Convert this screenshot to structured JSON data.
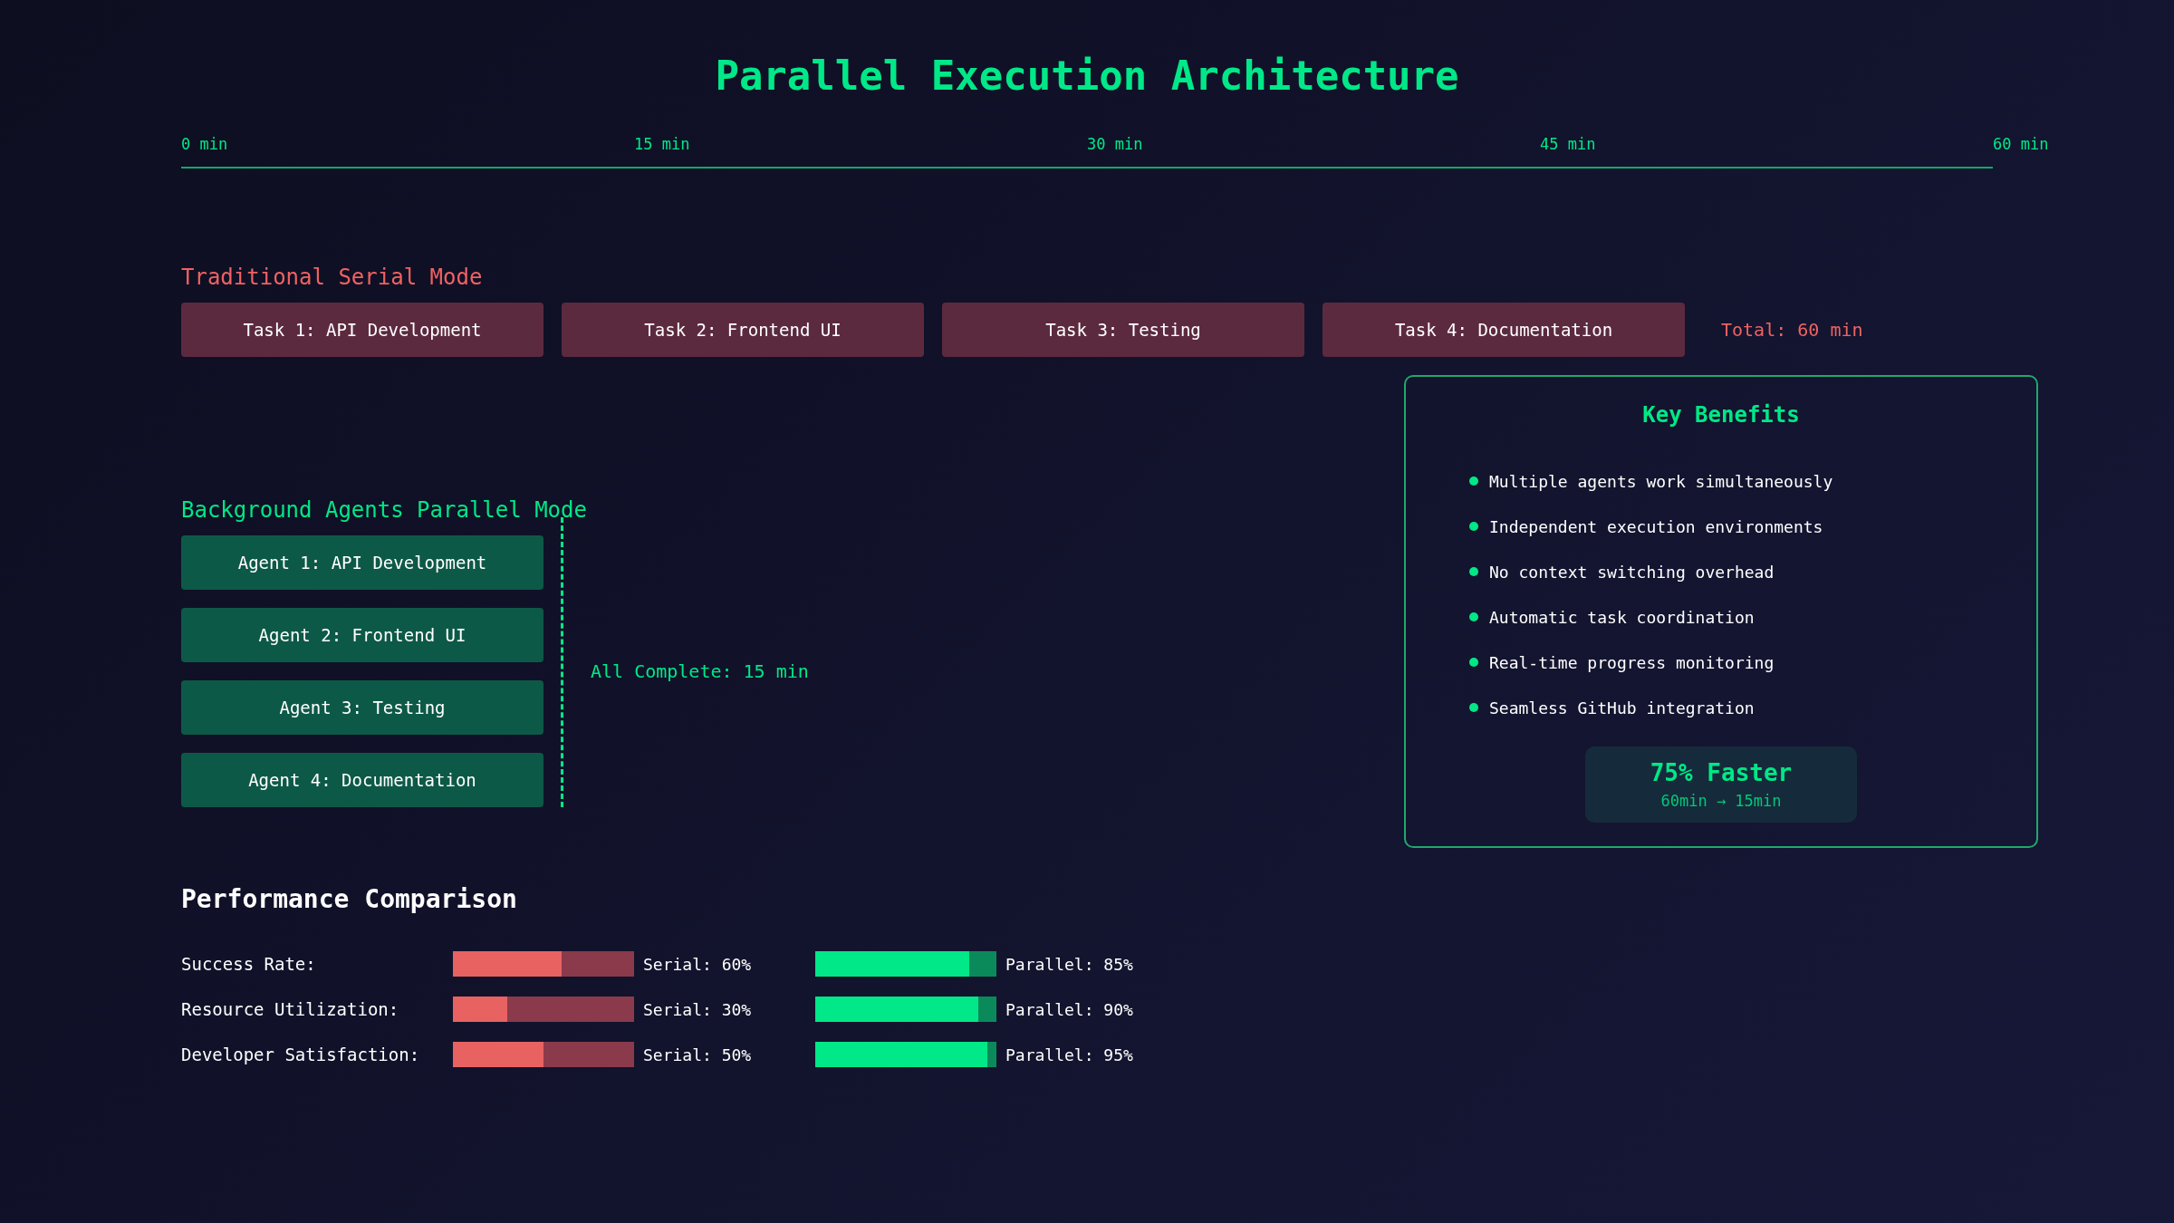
{
  "title": "Parallel Execution Architecture",
  "timeline": {
    "ticks": [
      "0 min",
      "15 min",
      "30 min",
      "45 min",
      "60 min"
    ]
  },
  "serial_mode": {
    "heading": "Traditional Serial Mode",
    "tasks": [
      "Task 1: API Development",
      "Task 2: Frontend UI",
      "Task 3: Testing",
      "Task 4: Documentation"
    ],
    "total": "Total: 60 min"
  },
  "parallel_mode": {
    "heading": "Background Agents Parallel Mode",
    "agents": [
      "Agent 1: API Development",
      "Agent 2: Frontend UI",
      "Agent 3: Testing",
      "Agent 4: Documentation"
    ],
    "complete_label": "All Complete: 15 min"
  },
  "key_benefits": {
    "title": "Key Benefits",
    "items": [
      "Multiple agents work simultaneously",
      "Independent execution environments",
      "No context switching overhead",
      "Automatic task coordination",
      "Real-time progress monitoring",
      "Seamless GitHub integration"
    ],
    "badge": {
      "headline": "75% Faster",
      "detail": "60min → 15min"
    }
  },
  "performance": {
    "heading": "Performance Comparison",
    "metrics": [
      {
        "label": "Success Rate:",
        "serial": {
          "level": 0.6,
          "reading": "Serial: 60%"
        },
        "parallel": {
          "level": 0.85,
          "reading": "Parallel: 85%"
        }
      },
      {
        "label": "Resource Utilization:",
        "serial": {
          "level": 0.3,
          "reading": "Serial: 30%"
        },
        "parallel": {
          "level": 0.9,
          "reading": "Parallel: 90%"
        }
      },
      {
        "label": "Developer Satisfaction:",
        "serial": {
          "level": 0.5,
          "reading": "Serial: 50%"
        },
        "parallel": {
          "level": 0.95,
          "reading": "Parallel: 95%"
        }
      }
    ]
  }
}
